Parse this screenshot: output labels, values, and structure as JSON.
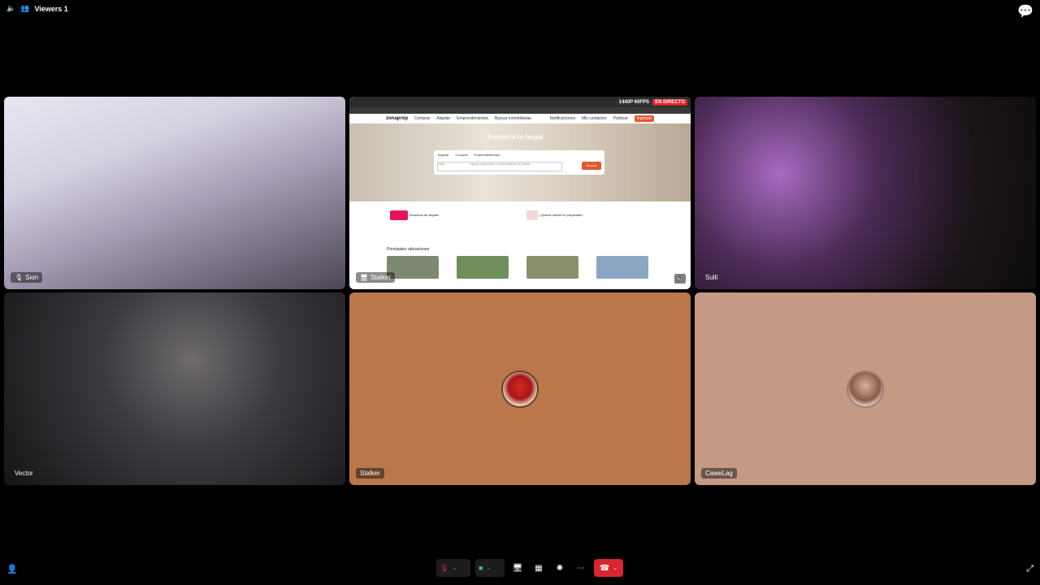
{
  "topbar": {
    "viewers": "Viewers 1"
  },
  "tiles": [
    {
      "name": "Sion"
    },
    {
      "name": "Stalker"
    },
    {
      "name": "Sulli"
    },
    {
      "name": "Vector"
    },
    {
      "name": "Stalker"
    },
    {
      "name": "CaweLag"
    }
  ],
  "screen": {
    "site_logo": "zonaprop",
    "nav": [
      "Comprar",
      "Alquilar",
      "Emprendimientos",
      "Buscar inmobiliarias"
    ],
    "nav_right": [
      "Notificaciones",
      "Mis contactos",
      "Publicar",
      "Ingresar"
    ],
    "hero_title": "Encontrá tu hogar",
    "search_tabs": [
      "Alquilar",
      "Comprar",
      "Emprendimientos"
    ],
    "search_placeholder": "Ingresá ubicaciones o características (ej. pileta)",
    "search_type": "Casa",
    "search_button": "Buscar",
    "promo1_title": "Garantías de alquiler",
    "promo2_title": "¿Querés vender tu propiedad?",
    "section": "Principales ubicaciones",
    "badge_quality": "1440P 60FPS",
    "badge_live": "EN DIRECTO"
  },
  "colors": {
    "accent": "#e4572e",
    "hangup": "#d7262e",
    "tile5": "#b9774a",
    "tile6": "#c49a84"
  }
}
